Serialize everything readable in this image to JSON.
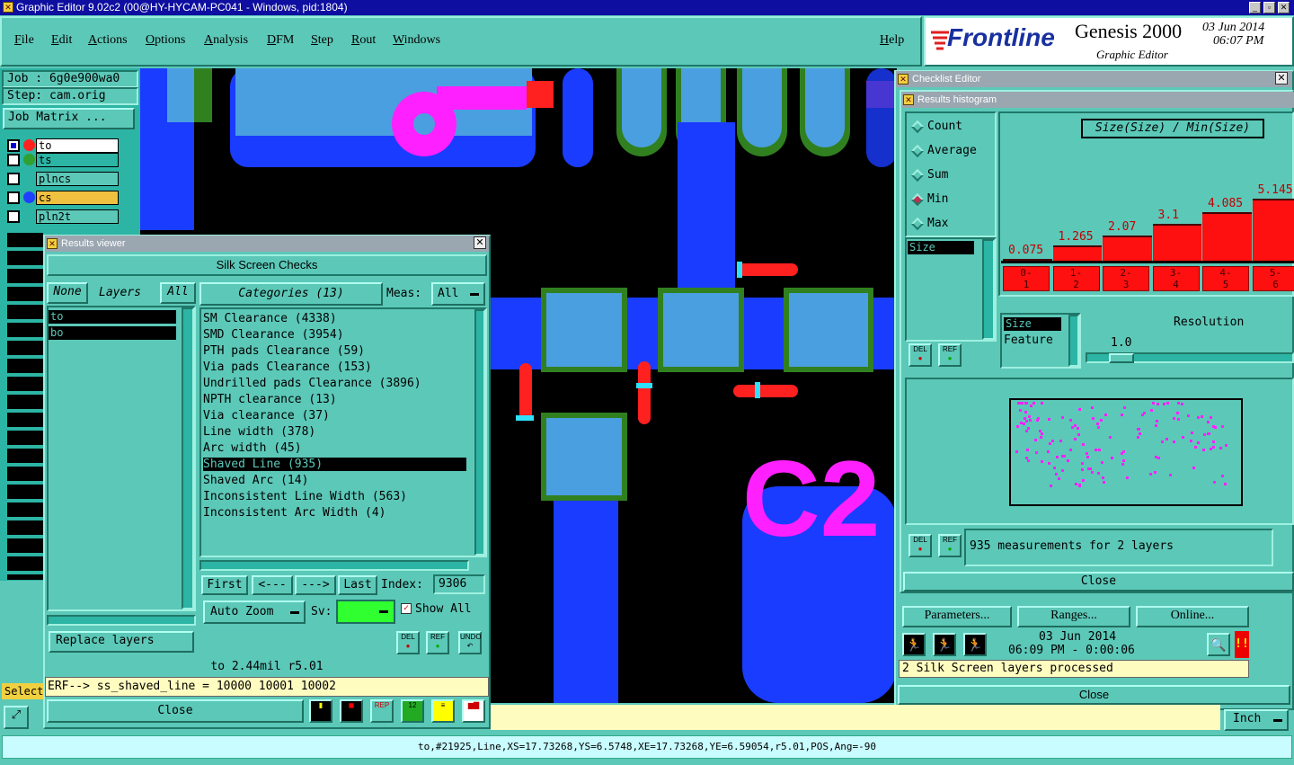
{
  "window": {
    "title": "Graphic Editor 9.02c2 (00@HY-HYCAM-PC041 - Windows, pid:1804)"
  },
  "menu": [
    "File",
    "Edit",
    "Actions",
    "Options",
    "Analysis",
    "DFM",
    "Step",
    "Rout",
    "Windows"
  ],
  "help": "Help",
  "brand": {
    "logo": "Frontline",
    "product": "Genesis 2000",
    "sub": "Graphic Editor",
    "date": "03 Jun 2014",
    "time": "06:07 PM"
  },
  "job": {
    "job_label": "Job : 6g0e900wa0",
    "step_label": "Step: cam.orig",
    "matrix_button": "Job Matrix ..."
  },
  "layers": [
    {
      "name": "to",
      "color": "#ff2020",
      "bg": "#ffffff"
    },
    {
      "name": "ts",
      "color": "#30a030",
      "bg": "#2cb4a4"
    },
    {
      "name": "plncs",
      "color": "",
      "bg": "#5cc8b8"
    },
    {
      "name": "cs",
      "color": "#2040ff",
      "bg": "#f0c040"
    },
    {
      "name": "pln2t",
      "color": "",
      "bg": "#5cc8b8"
    }
  ],
  "select_label": "Select",
  "results_viewer": {
    "title": "Results viewer",
    "header": "Silk Screen Checks",
    "none": "None",
    "layers": "Layers",
    "all": "All",
    "layer_items": [
      "to",
      "bo"
    ],
    "categories_label": "Categories (13)",
    "meas_label": "Meas:",
    "meas_value": "All",
    "categories": [
      "SM Clearance (4338)",
      "SMD Clearance (3954)",
      "PTH pads Clearance (59)",
      "Via pads Clearance (153)",
      "Undrilled pads Clearance (3896)",
      "NPTH clearance (13)",
      "Via clearance (37)",
      "Line width (378)",
      "Arc width (45)",
      "Shaved Line (935)",
      "Shaved Arc (14)",
      "Inconsistent Line Width (563)",
      "Inconsistent Arc Width (4)"
    ],
    "selected_index": 9,
    "nav": {
      "first": "First",
      "prev": "<---",
      "next": "--->",
      "last": "Last",
      "index_label": "Index:",
      "index_value": "9306"
    },
    "auto_zoom": "Auto Zoom",
    "sv_label": "Sv:",
    "show_all": "Show All",
    "replace_layers": "Replace layers",
    "del": "DEL",
    "ref": "REF",
    "undo": "UNDO",
    "status": "to 2.44mil   r5.01",
    "erf": "ERF--> ss_shaved_line = 10000 10001 10002",
    "close": "Close"
  },
  "canvas": {
    "label": "C2"
  },
  "checklist": {
    "title": "Checklist Editor",
    "histogram_title": "Results histogram",
    "radios": [
      "Count",
      "Average",
      "Sum",
      "Min",
      "Max"
    ],
    "selected_radio": "Min",
    "chart_title": "Size(Size) / Min(Size)",
    "size_item": "Size",
    "bins": [
      "0-\n1",
      "1-\n2",
      "2-\n3",
      "3-\n4",
      "4-\n5",
      "5-\n6"
    ],
    "values": [
      "0.075",
      "1.265",
      "2.07",
      "3.1",
      "4.085",
      "5.145"
    ],
    "size_box": "Size",
    "feature_label": "Feature",
    "resolution_label": "Resolution",
    "resolution_value": "1.0",
    "measurements": "935 measurements for 2 layers",
    "close": "Close",
    "params": "Parameters...",
    "ranges": "Ranges...",
    "online": "Online...",
    "run_date": "03 Jun 2014",
    "run_time": "06:09 PM - 0:00:06",
    "processed": "2 Silk Screen layers processed",
    "close2": "Close"
  },
  "chart_data": {
    "type": "bar",
    "title": "Size(Size) / Min(Size)",
    "categories": [
      "0-1",
      "1-2",
      "2-3",
      "3-4",
      "4-5",
      "5-6"
    ],
    "values": [
      0.075,
      1.265,
      2.07,
      3.1,
      4.085,
      5.145
    ]
  },
  "units": "Inch",
  "statusbar": "to,#21925,Line,XS=17.73268,YS=6.5748,XE=17.73268,YE=6.59054,r5.01,POS,Ang=-90"
}
